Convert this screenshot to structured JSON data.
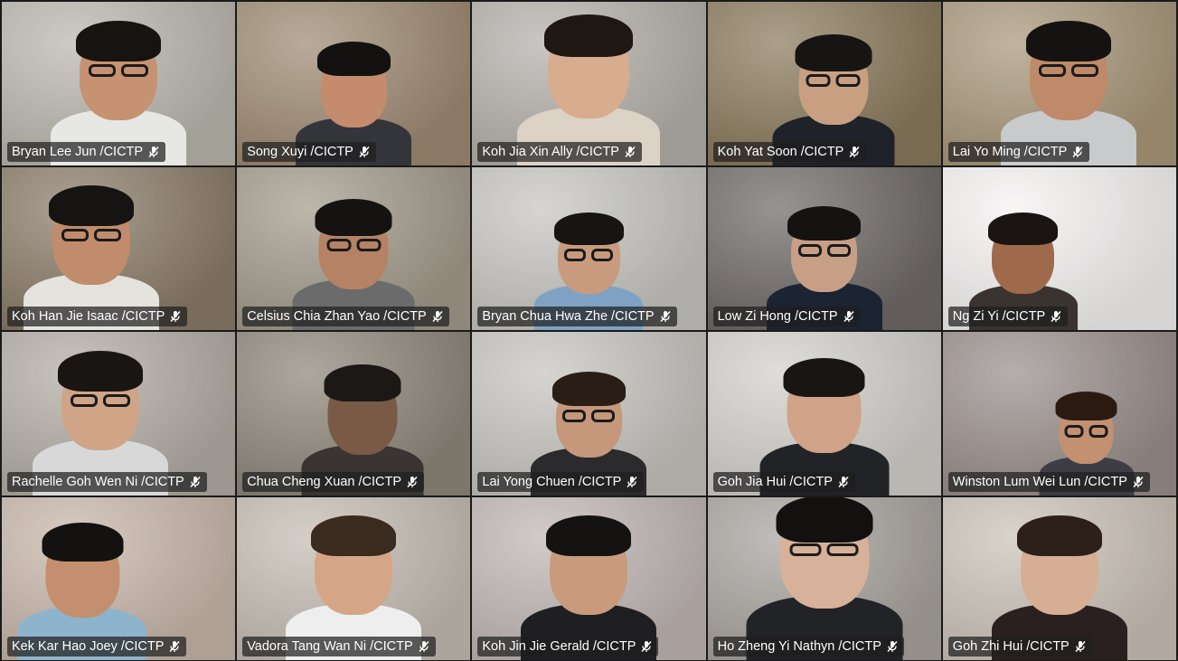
{
  "participants": [
    {
      "name": "Bryan Lee Jun /CICTP",
      "bg": "#b9b6ad",
      "skin": "#c69272",
      "shirt": "#e7e7e4",
      "hair": "#161311",
      "glasses": true
    },
    {
      "name": "Song Xuyi /CICTP",
      "bg": "#9e8a73",
      "skin": "#c48c6c",
      "shirt": "#34353b",
      "hair": "#141210",
      "glasses": false
    },
    {
      "name": "Koh Jia Xin Ally /CICTP",
      "bg": "#b4b0ab",
      "skin": "#d8ac8e",
      "shirt": "#dcd2c6",
      "hair": "#1e1712",
      "glasses": false
    },
    {
      "name": "Koh Yat Soon /CICTP",
      "bg": "#8a7a5c",
      "skin": "#c99f82",
      "shirt": "#202229",
      "hair": "#171513",
      "glasses": true
    },
    {
      "name": "Lai Yo Ming /CICTP",
      "bg": "#a8977a",
      "skin": "#be8a69",
      "shirt": "#c9cacb",
      "hair": "#151311",
      "glasses": true
    },
    {
      "name": "Koh Han Jie Isaac /CICTP",
      "bg": "#8a7b68",
      "skin": "#c08c6c",
      "shirt": "#e5e3de",
      "hair": "#161412",
      "glasses": true
    },
    {
      "name": "Celsius Chia Zhan Yao /CICTP",
      "bg": "#a29a8b",
      "skin": "#b58266",
      "shirt": "#6b6b6b",
      "hair": "#151311",
      "glasses": true
    },
    {
      "name": "Bryan Chua Hwa Zhe /CICTP",
      "bg": "#c6c5c0",
      "skin": "#c99b7e",
      "shirt": "#7fa2c4",
      "hair": "#171412",
      "glasses": true
    },
    {
      "name": "Low Zi Hong /CICTP",
      "bg": "#6f6a68",
      "skin": "#c69f86",
      "shirt": "#1c2332",
      "hair": "#151311",
      "glasses": true
    },
    {
      "name": "Ng Zi Yi /CICTP",
      "bg": "#f4f2f1",
      "skin": "#9f6a4c",
      "shirt": "#3a3330",
      "hair": "#1a1512",
      "glasses": false
    },
    {
      "name": "Rachelle Goh Wen Ni /CICTP",
      "bg": "#b2aca4",
      "skin": "#d0a487",
      "shirt": "#d8d8d8",
      "hair": "#191512",
      "glasses": true
    },
    {
      "name": "Chua Cheng Xuan /CICTP",
      "bg": "#8d867a",
      "skin": "#7a5a46",
      "shirt": "#3a3532",
      "hair": "#1c1815",
      "glasses": false
    },
    {
      "name": "Lai Yong Chuen /CICTP",
      "bg": "#c7c4bf",
      "skin": "#c5977b",
      "shirt": "#2b2b2e",
      "hair": "#2a1d16",
      "glasses": true
    },
    {
      "name": "Goh Jia Hui /CICTP",
      "bg": "#d2d0cb",
      "skin": "#d0a388",
      "shirt": "#222327",
      "hair": "#181513",
      "glasses": false
    },
    {
      "name": "Winston Lum Wei Lun /CICTP",
      "bg": "#9a8f8c",
      "skin": "#c39071",
      "shirt": "#3e3d45",
      "hair": "#2a1a12",
      "glasses": true
    },
    {
      "name": "Kek Kar Hao Joey /CICTP",
      "bg": "#c7b6aa",
      "skin": "#c48f6e",
      "shirt": "#8eb3cc",
      "hair": "#141210",
      "glasses": false
    },
    {
      "name": "Vadora Tang Wan Ni /CICTP",
      "bg": "#c4bcb3",
      "skin": "#d4a586",
      "shirt": "#eeeeee",
      "hair": "#3b2a1e",
      "glasses": false
    },
    {
      "name": "Koh Jin Jie Gerald /CICTP",
      "bg": "#c0b6b4",
      "skin": "#c99a7c",
      "shirt": "#1f1f22",
      "hair": "#151311",
      "glasses": false
    },
    {
      "name": "Ho Zheng Yi Nathyn /CICTP",
      "bg": "#a8a39e",
      "skin": "#d8b19a",
      "shirt": "#222326",
      "hair": "#121110",
      "glasses": true
    },
    {
      "name": "Goh Zhi Hui /CICTP",
      "bg": "#cbc2b8",
      "skin": "#d6ae94",
      "shirt": "#2b2020",
      "hair": "#2c2018",
      "glasses": false
    }
  ],
  "icons": {
    "muted": "microphone-muted-icon"
  }
}
